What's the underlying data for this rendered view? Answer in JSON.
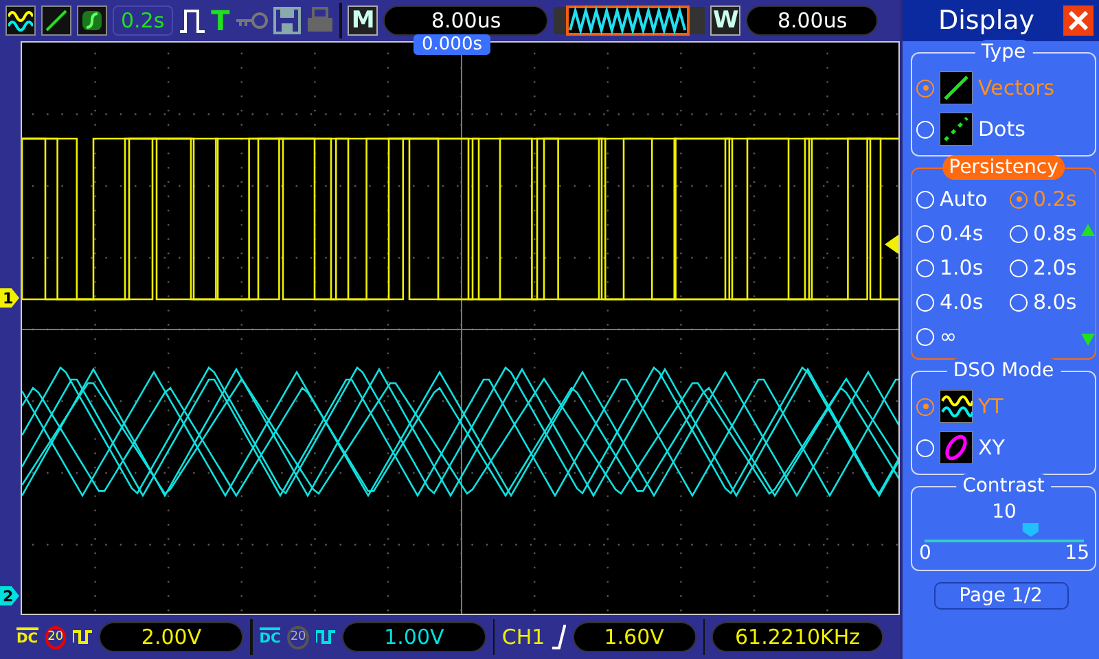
{
  "top_bar": {
    "persistence_time": "0.2s",
    "trigger_mode_label": "T",
    "m_label": "M",
    "horizontal_scale": "8.00us",
    "w_label": "W",
    "window_scale": "8.00us"
  },
  "scope": {
    "trigger_position": "0.000s",
    "markers": [
      {
        "label": "1",
        "color": "#f0f000"
      },
      {
        "label": "2",
        "color": "#00e0e0"
      }
    ]
  },
  "channels": [
    {
      "coupling": "DC",
      "bw_label": "20",
      "bw_limit": true,
      "scale": "2.00V",
      "color": "#f0f000"
    },
    {
      "coupling": "DC",
      "bw_label": "20",
      "bw_limit": false,
      "scale": "1.00V",
      "color": "#00e0e0"
    }
  ],
  "trigger": {
    "source": "CH1",
    "level": "1.60V"
  },
  "frequency": "61.2210KHz",
  "menu": {
    "title": "Display",
    "type": {
      "title": "Type",
      "options": [
        {
          "label": "Vectors",
          "kind": "vectors",
          "selected": true
        },
        {
          "label": "Dots",
          "kind": "dots",
          "selected": false
        }
      ]
    },
    "persistency": {
      "title": "Persistency",
      "options": [
        {
          "label": "Auto",
          "selected": false
        },
        {
          "label": "0.2s",
          "selected": true
        },
        {
          "label": "0.4s",
          "selected": false
        },
        {
          "label": "0.8s",
          "selected": false
        },
        {
          "label": "1.0s",
          "selected": false
        },
        {
          "label": "2.0s",
          "selected": false
        },
        {
          "label": "4.0s",
          "selected": false
        },
        {
          "label": "8.0s",
          "selected": false
        },
        {
          "label": "∞",
          "selected": false
        }
      ]
    },
    "dso_mode": {
      "title": "DSO Mode",
      "options": [
        {
          "label": "YT",
          "kind": "yt",
          "selected": true
        },
        {
          "label": "XY",
          "kind": "xy",
          "selected": false
        }
      ]
    },
    "contrast": {
      "title": "Contrast",
      "value": "10",
      "level": 0.667,
      "min": "0",
      "max": "15"
    },
    "page_button": "Page 1/2"
  }
}
